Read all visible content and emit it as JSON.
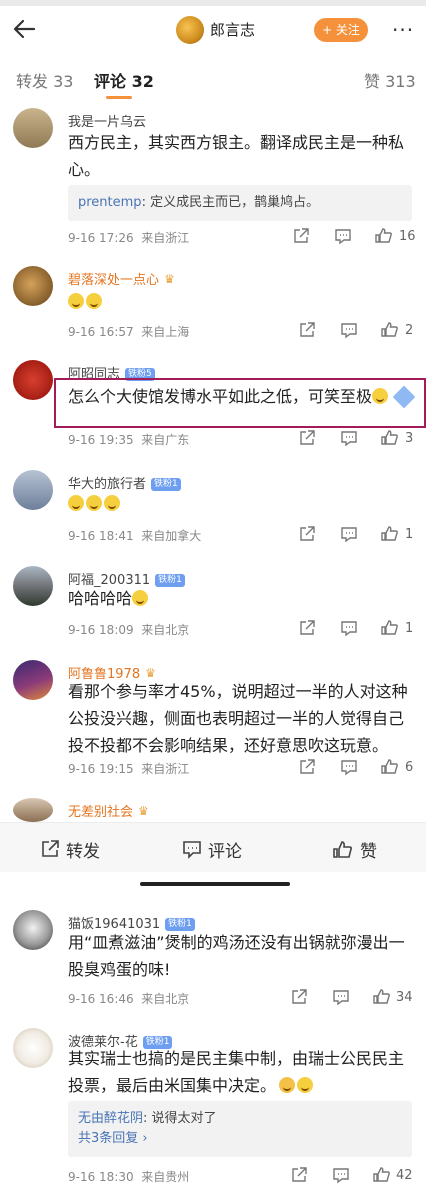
{
  "header": {
    "author_name": "郎言志",
    "follow_label": "+ 关注",
    "more": "···"
  },
  "tabs": {
    "repost_label": "转发 33",
    "comment_label": "评论 32",
    "like_label": "赞 313"
  },
  "comments": [
    {
      "user": "我是一片乌云",
      "text": "西方民主，其实西方银主。翻译成民主是一种私心。",
      "reply_user": "prentemp",
      "reply_text": ": 定义成民主而已，鹊巢鸠占。",
      "time": "9-16 17:26",
      "loc": "来自浙江",
      "likes": "16"
    },
    {
      "user": "碧落深处一点心",
      "text": "",
      "time": "9-16 16:57",
      "loc": "来自上海",
      "likes": "2"
    },
    {
      "user": "阿昭同志",
      "badge": "铁粉5",
      "text": "怎么个大使馆发博水平如此之低，可笑至极",
      "time": "9-16 19:35",
      "loc": "来自广东",
      "likes": "3"
    },
    {
      "user": "华大的旅行者",
      "badge": "铁粉1",
      "text": "",
      "time": "9-16 18:41",
      "loc": "来自加拿大",
      "likes": "1"
    },
    {
      "user": "阿福_200311",
      "badge": "铁粉1",
      "text": "哈哈哈哈",
      "time": "9-16 18:09",
      "loc": "来自北京",
      "likes": "1"
    },
    {
      "user": "阿鲁鲁1978",
      "text": "看那个参与率才45%，说明超过一半的人对这种公投没兴趣，侧面也表明超过一半的人觉得自己投不投都不会影响结果，还好意思吹这玩意。",
      "time": "9-16 19:15",
      "loc": "来自浙江",
      "likes": "6"
    },
    {
      "user": "无差别社会"
    },
    {
      "user": "猫饭19641031",
      "badge": "铁粉1",
      "text": "用“皿煮滋油”煲制的鸡汤还没有出锅就弥漫出一股臭鸡蛋的味!",
      "time": "9-16 16:46",
      "loc": "来自北京",
      "likes": "34"
    },
    {
      "user": "波德莱尔-花",
      "badge": "铁粉1",
      "text": "其实瑞士也搞的是民主集中制，由瑞士公民民主投票，最后由米国集中决定。",
      "reply_user": "无由醉花阴",
      "reply_text": ": 说得太对了",
      "reply_more": "共3条回复 ›",
      "time": "9-16 18:30",
      "loc": "来自贵州",
      "likes": "42"
    }
  ],
  "bottom_bar": {
    "repost": "转发",
    "comment": "评论",
    "like": "赞"
  }
}
